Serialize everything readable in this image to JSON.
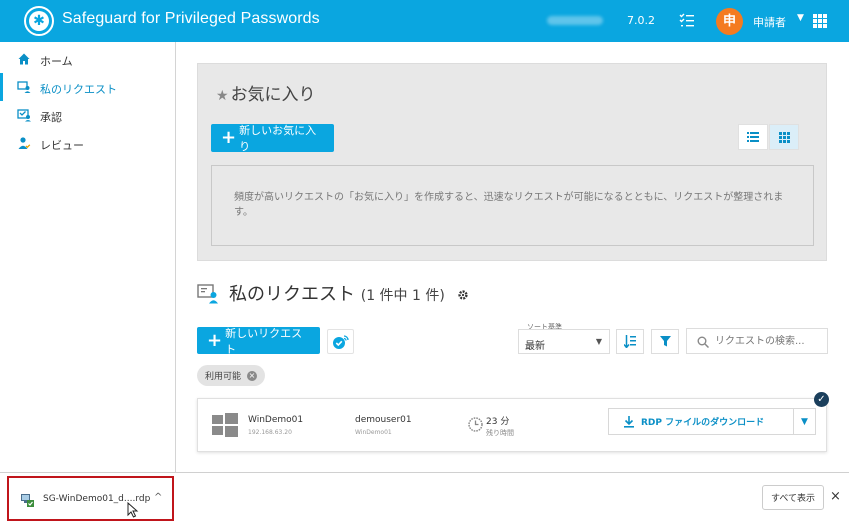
{
  "header": {
    "app_title": "Safeguard for Privileged Passwords",
    "version": "7.0.2",
    "avatar_text": "申",
    "user_name": "申請者",
    "bg_color": "#0aa6e0",
    "avatar_color": "#f47b20"
  },
  "sidebar": {
    "items": [
      {
        "label": "ホーム",
        "icon": "home-icon"
      },
      {
        "label": "私のリクエスト",
        "icon": "my-requests-icon"
      },
      {
        "label": "承認",
        "icon": "approval-icon"
      },
      {
        "label": "レビュー",
        "icon": "review-icon"
      }
    ]
  },
  "favorites": {
    "title": "お気に入り",
    "new_button": "新しいお気に入り",
    "empty_text": "頻度が高いリクエストの「お気に入り」を作成すると、迅速なリクエストが可能になるとともに、リクエストが整理されます。"
  },
  "requests": {
    "title": "私のリクエスト",
    "count_text": "(1 件中 1 件)",
    "new_button": "新しいリクエスト",
    "sort_label": "ソート基準",
    "sort_value": "最新",
    "search_placeholder": "リクエストの検索...",
    "filter_chip": "利用可能",
    "card": {
      "asset_name": "WinDemo01",
      "asset_ip": "192.168.63.20",
      "account_name": "demouser01",
      "account_asset": "WinDemo01",
      "time_value": "23 分",
      "time_label": "残り時間",
      "download_button": "RDP ファイルのダウンロード"
    }
  },
  "download_bar": {
    "file_name": "SG-WinDemo01_d....rdp",
    "show_all": "すべて表示",
    "close": "×"
  }
}
